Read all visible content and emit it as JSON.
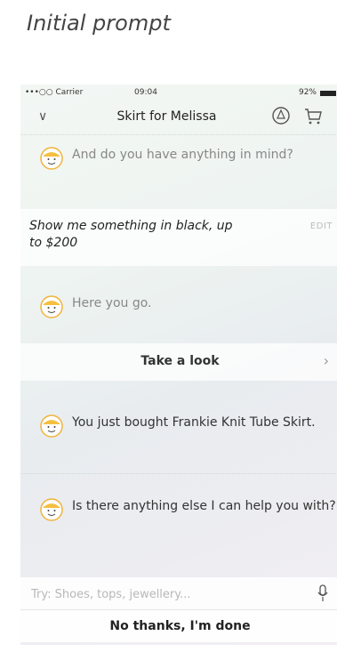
{
  "caption": "Initial prompt",
  "status": {
    "carrier": "•••○○ Carrier",
    "time": "09:04",
    "battery": "92%"
  },
  "nav": {
    "title": "Skirt for Melissa"
  },
  "messages": {
    "bot1": "And do you have anything in mind?",
    "user1": "Show me something in black, up to $200",
    "user1_edit": "EDIT",
    "bot2": "Here you go.",
    "take_look": "Take a look",
    "bot3": "You just bought Frankie Knit Tube Skirt.",
    "bot4": "Is there anything else I can help you with?"
  },
  "input": {
    "placeholder": "Try: Shoes, tops, jewellery..."
  },
  "done_button": "No thanks, I'm done"
}
